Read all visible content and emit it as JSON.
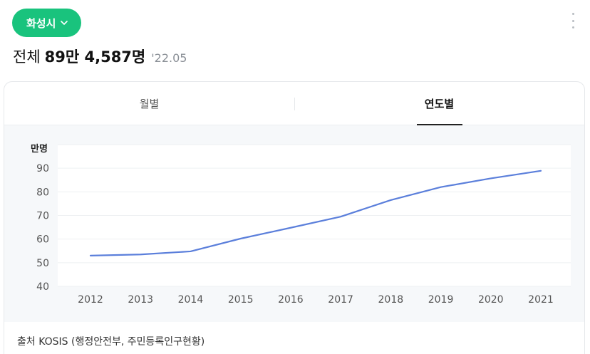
{
  "header": {
    "region_label": "화성시",
    "summary_label": "전체",
    "summary_value": "89만 4,587명",
    "summary_date": "'22.05"
  },
  "tabs": [
    {
      "label": "월별",
      "active": false
    },
    {
      "label": "연도별",
      "active": true
    }
  ],
  "source": "출처 KOSIS (행정안전부, 주민등록인구현황)",
  "colors": {
    "accent": "#19c37d",
    "line": "#5b7fdb"
  },
  "icons": {
    "region_chevron": "chevron-down-icon",
    "more": "more-vertical-icon"
  },
  "chart_data": {
    "type": "line",
    "ylabel": "만명",
    "ylim": [
      40,
      100
    ],
    "yticks": [
      40,
      50,
      60,
      70,
      80,
      90
    ],
    "x": [
      "2012",
      "2013",
      "2014",
      "2015",
      "2016",
      "2017",
      "2018",
      "2019",
      "2020",
      "2021"
    ],
    "series": [
      {
        "values": [
          53.0,
          53.5,
          54.8,
          60.2,
          64.8,
          69.5,
          76.5,
          82.0,
          85.7,
          88.9
        ]
      }
    ],
    "grid": true
  }
}
